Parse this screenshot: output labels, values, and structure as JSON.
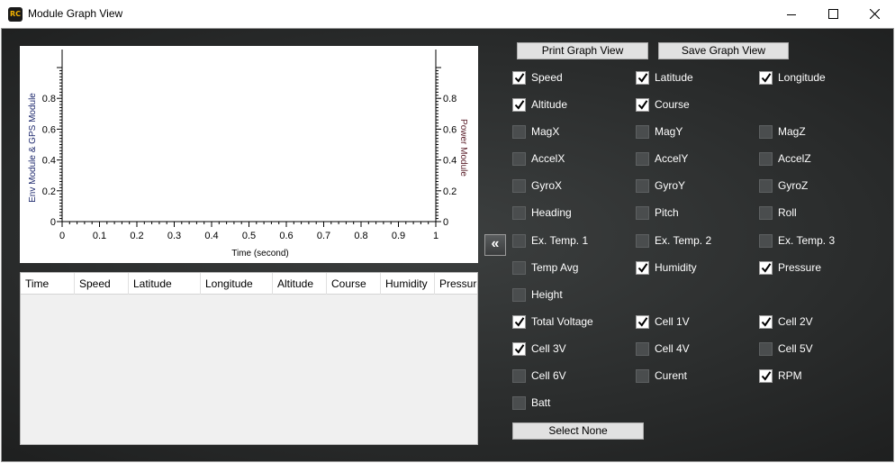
{
  "window": {
    "app_icon_text": "RC",
    "title": "Module Graph View"
  },
  "chart_data": {
    "type": "line",
    "x": [],
    "series": [],
    "xlabel": "Time (second)",
    "ylabel_left": "Env Module & GPS Module",
    "ylabel_right": "Power Module",
    "xlim": [
      0,
      1
    ],
    "ylim_left": [
      0,
      1
    ],
    "ylim_right": [
      0,
      1
    ],
    "x_ticks": [
      "0",
      "0.1",
      "0.2",
      "0.3",
      "0.4",
      "0.5",
      "0.6",
      "0.7",
      "0.8",
      "0.9",
      "1"
    ],
    "y_ticks_left": [
      "0",
      "0.2",
      "0.4",
      "0.6",
      "0.8"
    ],
    "y_ticks_right": [
      "0",
      "0.2",
      "0.4",
      "0.6",
      "0.8"
    ],
    "grid": false
  },
  "table": {
    "columns": [
      "Time",
      "Speed",
      "Latitude",
      "Longitude",
      "Altitude",
      "Course",
      "Humidity",
      "Pressure"
    ],
    "rows": []
  },
  "buttons": {
    "print": "Print Graph View",
    "save": "Save Graph View",
    "select_none": "Select None",
    "collapse": "«"
  },
  "checkboxes": [
    {
      "label": "Speed",
      "checked": true
    },
    {
      "label": "Latitude",
      "checked": true
    },
    {
      "label": "Longitude",
      "checked": true
    },
    {
      "label": "Altitude",
      "checked": true
    },
    {
      "label": "Course",
      "checked": true
    },
    {
      "label": "",
      "checked": null
    },
    {
      "label": "MagX",
      "checked": false
    },
    {
      "label": "MagY",
      "checked": false
    },
    {
      "label": "MagZ",
      "checked": false
    },
    {
      "label": "AccelX",
      "checked": false
    },
    {
      "label": "AccelY",
      "checked": false
    },
    {
      "label": "AccelZ",
      "checked": false
    },
    {
      "label": "GyroX",
      "checked": false
    },
    {
      "label": "GyroY",
      "checked": false
    },
    {
      "label": "GyroZ",
      "checked": false
    },
    {
      "label": "Heading",
      "checked": false
    },
    {
      "label": "Pitch",
      "checked": false
    },
    {
      "label": "Roll",
      "checked": false
    },
    {
      "label": "Ex. Temp. 1",
      "checked": false
    },
    {
      "label": "Ex. Temp. 2",
      "checked": false
    },
    {
      "label": "Ex. Temp. 3",
      "checked": false
    },
    {
      "label": "Temp Avg",
      "checked": false
    },
    {
      "label": "Humidity",
      "checked": true
    },
    {
      "label": "Pressure",
      "checked": true
    },
    {
      "label": "Height",
      "checked": false
    },
    {
      "label": "",
      "checked": null
    },
    {
      "label": "",
      "checked": null
    },
    {
      "label": "Total Voltage",
      "checked": true
    },
    {
      "label": "Cell 1V",
      "checked": true
    },
    {
      "label": "Cell 2V",
      "checked": true
    },
    {
      "label": "Cell 3V",
      "checked": true
    },
    {
      "label": "Cell 4V",
      "checked": false
    },
    {
      "label": "Cell 5V",
      "checked": false
    },
    {
      "label": "Cell 6V",
      "checked": false
    },
    {
      "label": "Curent",
      "checked": false
    },
    {
      "label": "RPM",
      "checked": true
    },
    {
      "label": "Batt",
      "checked": false
    }
  ],
  "colors": {
    "panel_background": "#2f3131",
    "chart_left_axis_title": "#1f2a6e",
    "chart_right_axis_title": "#5a1f2a"
  }
}
